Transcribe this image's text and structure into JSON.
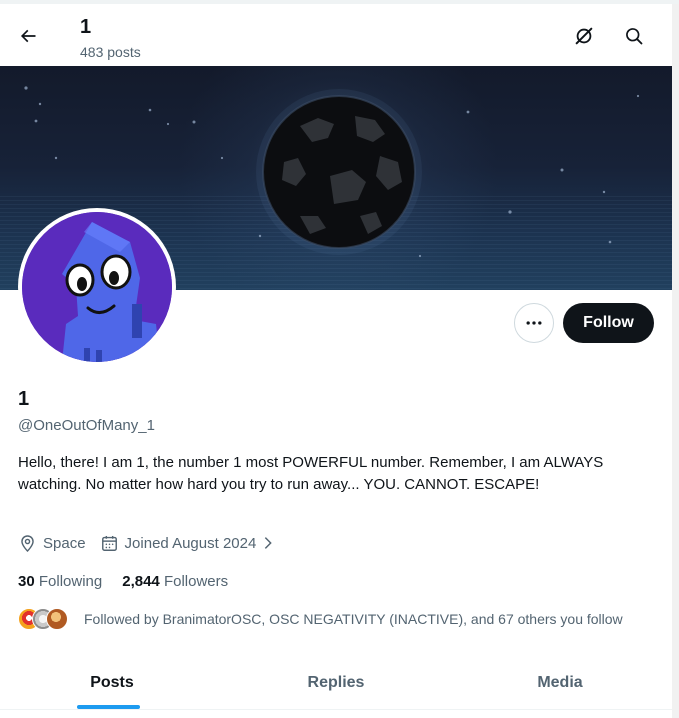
{
  "header": {
    "title": "1",
    "post_count": "483 posts"
  },
  "profile": {
    "display_name": "1",
    "handle": "@OneOutOfMany_1",
    "bio": "Hello, there! I am 1, the number 1 most POWERFUL number. Remember, I am ALWAYS watching. No matter how hard you try to run away... YOU. CANNOT. ESCAPE!",
    "location": "Space",
    "joined": "Joined August 2024",
    "following_count": "30",
    "following_label": "Following",
    "followers_count": "2,844",
    "followers_label": "Followers",
    "followed_by": "Followed by BranimatorOSC, OSC NEGATIVITY (INACTIVE), and 67 others you follow"
  },
  "actions": {
    "follow_label": "Follow"
  },
  "tabs": [
    {
      "label": "Posts",
      "active": true
    },
    {
      "label": "Replies",
      "active": false
    },
    {
      "label": "Media",
      "active": false
    }
  ],
  "colors": {
    "accent": "#1d9bf0",
    "follow_button": "#0f1419",
    "secondary_text": "#536471",
    "avatar_background": "#5a2bbd",
    "avatar_character": "#4f67e8"
  },
  "icons": {
    "back": "arrow-left-icon",
    "grok": "grok-icon",
    "search": "search-icon",
    "more": "more-horizontal-icon",
    "location": "location-pin-icon",
    "calendar": "calendar-icon",
    "chevron": "chevron-right-icon"
  }
}
